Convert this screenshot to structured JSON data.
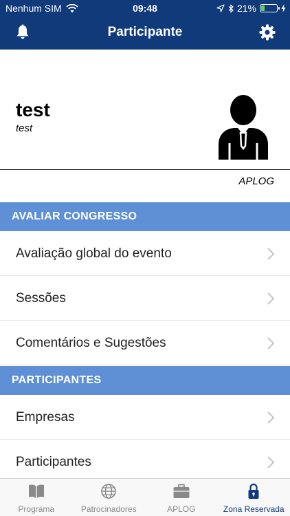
{
  "status_bar": {
    "carrier": "Nenhum SIM",
    "time": "09:48",
    "battery_percent": "21%",
    "battery_level": 0.21,
    "icons": [
      "wifi-icon",
      "location-arrow-icon",
      "bluetooth-icon",
      "battery-icon",
      "charging-bolt-icon"
    ]
  },
  "nav": {
    "title": "Participante",
    "left_icon": "bell-icon",
    "right_icon": "gear-icon"
  },
  "profile": {
    "name": "test",
    "subtitle": "test",
    "organization": "APLOG",
    "avatar_icon": "person-avatar-icon"
  },
  "sections": [
    {
      "title": "AVALIAR CONGRESSO",
      "items": [
        "Avaliação global do evento",
        "Sessões",
        "Comentários e Sugestões"
      ]
    },
    {
      "title": "PARTICIPANTES",
      "items": [
        "Empresas",
        "Participantes"
      ]
    }
  ],
  "tabbar": {
    "tabs": [
      {
        "label": "Programa",
        "icon": "book-icon"
      },
      {
        "label": "Patrocinadores",
        "icon": "globe-icon"
      },
      {
        "label": "APLOG",
        "icon": "briefcase-icon"
      },
      {
        "label": "Zona Reservada",
        "icon": "lock-icon"
      }
    ],
    "active_tab": "Zona Reservada"
  },
  "colors": {
    "header_bg": "#103a7a",
    "section_bg": "#5f8fd4",
    "active_tab": "#103a7a",
    "inactive_tab": "#8a8a8a",
    "battery_fill": "#5fd35f"
  }
}
